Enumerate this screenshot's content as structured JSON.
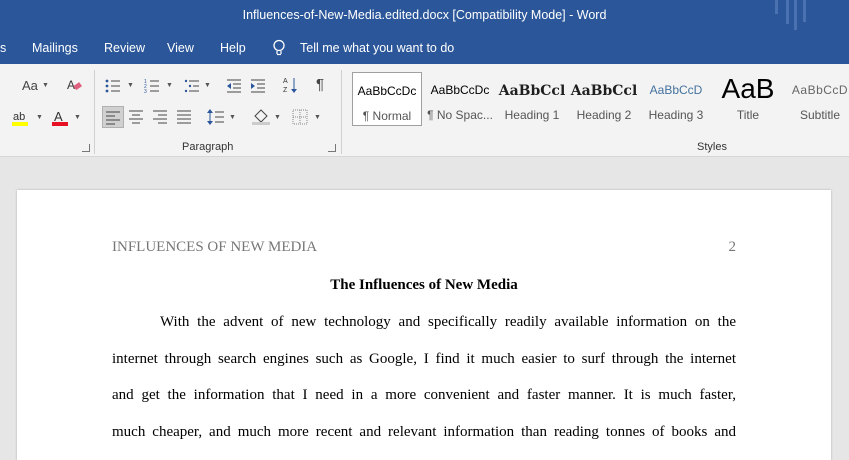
{
  "window": {
    "title": "Influences-of-New-Media.edited.docx [Compatibility Mode]  -  Word"
  },
  "tabs": {
    "partial": "s",
    "mailings": "Mailings",
    "review": "Review",
    "view": "View",
    "help": "Help",
    "tell_me": "Tell me what you want to do"
  },
  "ribbon": {
    "font_group": {
      "change_case": "Aa"
    },
    "paragraph_group": {
      "label": "Paragraph"
    },
    "styles_group": {
      "label": "Styles",
      "items": [
        {
          "preview": "AaBbCcDc",
          "name": "¶ Normal",
          "selected": true
        },
        {
          "preview": "AaBbCcDc",
          "name": "¶ No Spac..."
        },
        {
          "preview": "AaBbCcl",
          "name": "Heading 1"
        },
        {
          "preview": "AaBbCcl",
          "name": "Heading 2"
        },
        {
          "preview": "AaBbCcD",
          "name": "Heading 3"
        },
        {
          "preview": "AaB",
          "name": "Title"
        },
        {
          "preview": "AaBbCcD",
          "name": "Subtitle"
        }
      ]
    },
    "colors": {
      "highlight": "#ffff00",
      "font_color": "#e81123",
      "accent": "#2b579a"
    },
    "icons": [
      "change-case-icon",
      "clear-formatting-icon",
      "highlight-icon",
      "font-color-icon",
      "bullets-icon",
      "numbering-icon",
      "multilevel-list-icon",
      "decrease-indent-icon",
      "increase-indent-icon",
      "sort-icon",
      "pilcrow-icon",
      "align-left-icon",
      "align-center-icon",
      "align-right-icon",
      "justify-icon",
      "line-spacing-icon",
      "shading-icon",
      "borders-icon",
      "lightbulb-icon"
    ]
  },
  "document": {
    "header_left": "INFLUENCES OF NEW MEDIA",
    "page_number": "2",
    "title": "The Influences of New Media",
    "lines": [
      "With the advent of new technology and specifically readily available information on the",
      "internet through search engines such as Google, I find it much easier to surf through the internet",
      "and get the information that I need in a more convenient and faster manner. It is much faster,",
      "much cheaper, and much more recent and relevant information than reading tonnes of books and"
    ]
  }
}
